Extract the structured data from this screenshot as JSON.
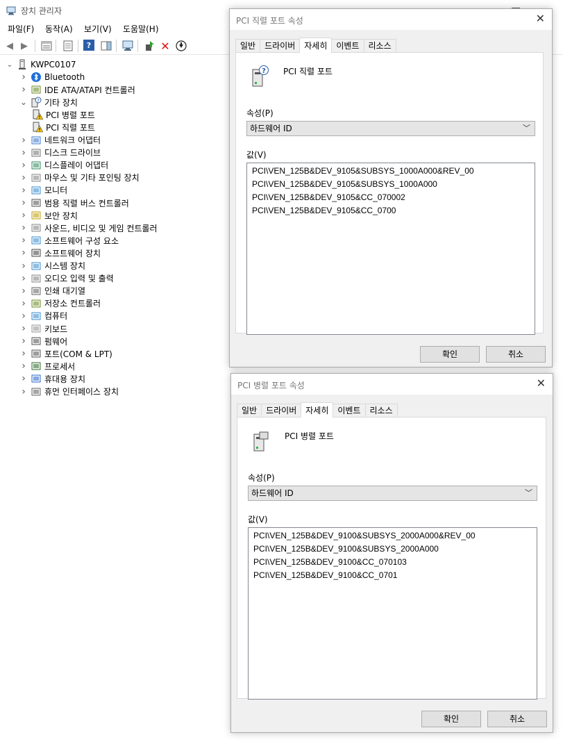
{
  "window": {
    "title": "장치 관리자"
  },
  "menu": [
    "파일(F)",
    "동작(A)",
    "보기(V)",
    "도움말(H)"
  ],
  "tree": {
    "root": "KWPC0107",
    "items": [
      {
        "label": "Bluetooth",
        "icon": "bluetooth-icon",
        "expanded": false
      },
      {
        "label": "IDE ATA/ATAPI 컨트롤러",
        "icon": "ide-controller-icon",
        "expanded": false
      },
      {
        "label": "기타 장치",
        "icon": "unknown-device-icon",
        "expanded": true
      },
      {
        "label": "PCI 병렬 포트",
        "icon": "warning-device-icon",
        "child": true
      },
      {
        "label": "PCI 직렬 포트",
        "icon": "warning-device-icon",
        "child": true
      },
      {
        "label": "네트워크 어댑터",
        "icon": "network-icon",
        "expanded": false
      },
      {
        "label": "디스크 드라이브",
        "icon": "disk-icon",
        "expanded": false
      },
      {
        "label": "디스플레이 어댑터",
        "icon": "display-adapter-icon",
        "expanded": false
      },
      {
        "label": "마우스 및 기타 포인팅 장치",
        "icon": "mouse-icon",
        "expanded": false
      },
      {
        "label": "모니터",
        "icon": "monitor-icon",
        "expanded": false
      },
      {
        "label": "범용 직렬 버스 컨트롤러",
        "icon": "usb-icon",
        "expanded": false
      },
      {
        "label": "보안 장치",
        "icon": "security-icon",
        "expanded": false
      },
      {
        "label": "사운드, 비디오 및 게임 컨트롤러",
        "icon": "speaker-icon",
        "expanded": false
      },
      {
        "label": "소프트웨어 구성 요소",
        "icon": "software-component-icon",
        "expanded": false
      },
      {
        "label": "소프트웨어 장치",
        "icon": "software-device-icon",
        "expanded": false
      },
      {
        "label": "시스템 장치",
        "icon": "system-device-icon",
        "expanded": false
      },
      {
        "label": "오디오 입력 및 출력",
        "icon": "audio-icon",
        "expanded": false
      },
      {
        "label": "인쇄 대기열",
        "icon": "printer-icon",
        "expanded": false
      },
      {
        "label": "저장소 컨트롤러",
        "icon": "storage-controller-icon",
        "expanded": false
      },
      {
        "label": "컴퓨터",
        "icon": "computer-icon",
        "expanded": false
      },
      {
        "label": "키보드",
        "icon": "keyboard-icon",
        "expanded": false
      },
      {
        "label": "펌웨어",
        "icon": "firmware-icon",
        "expanded": false
      },
      {
        "label": "포트(COM & LPT)",
        "icon": "port-icon",
        "expanded": false
      },
      {
        "label": "프로세서",
        "icon": "processor-icon",
        "expanded": false
      },
      {
        "label": "휴대용 장치",
        "icon": "portable-device-icon",
        "expanded": false
      },
      {
        "label": "휴먼 인터페이스 장치",
        "icon": "hid-icon",
        "expanded": false
      }
    ]
  },
  "dialog_serial": {
    "title": "PCI 직렬 포트 속성",
    "tabs": [
      "일반",
      "드라이버",
      "자세히",
      "이벤트",
      "리소스"
    ],
    "active_tab": 2,
    "device_name": "PCI 직렬 포트",
    "property_label": "속성(P)",
    "property_value": "하드웨어 ID",
    "value_label": "값(V)",
    "values": [
      "PCI\\VEN_125B&DEV_9105&SUBSYS_1000A000&REV_00",
      "PCI\\VEN_125B&DEV_9105&SUBSYS_1000A000",
      "PCI\\VEN_125B&DEV_9105&CC_070002",
      "PCI\\VEN_125B&DEV_9105&CC_0700"
    ],
    "ok": "확인",
    "cancel": "취소"
  },
  "dialog_parallel": {
    "title": "PCI 병렬 포트 속성",
    "tabs": [
      "일반",
      "드라이버",
      "자세히",
      "이벤트",
      "리소스"
    ],
    "active_tab": 2,
    "device_name": "PCI 병렬 포트",
    "property_label": "속성(P)",
    "property_value": "하드웨어 ID",
    "value_label": "값(V)",
    "values": [
      "PCI\\VEN_125B&DEV_9100&SUBSYS_2000A000&REV_00",
      "PCI\\VEN_125B&DEV_9100&SUBSYS_2000A000",
      "PCI\\VEN_125B&DEV_9100&CC_070103",
      "PCI\\VEN_125B&DEV_9100&CC_0701"
    ],
    "ok": "확인",
    "cancel": "취소"
  }
}
